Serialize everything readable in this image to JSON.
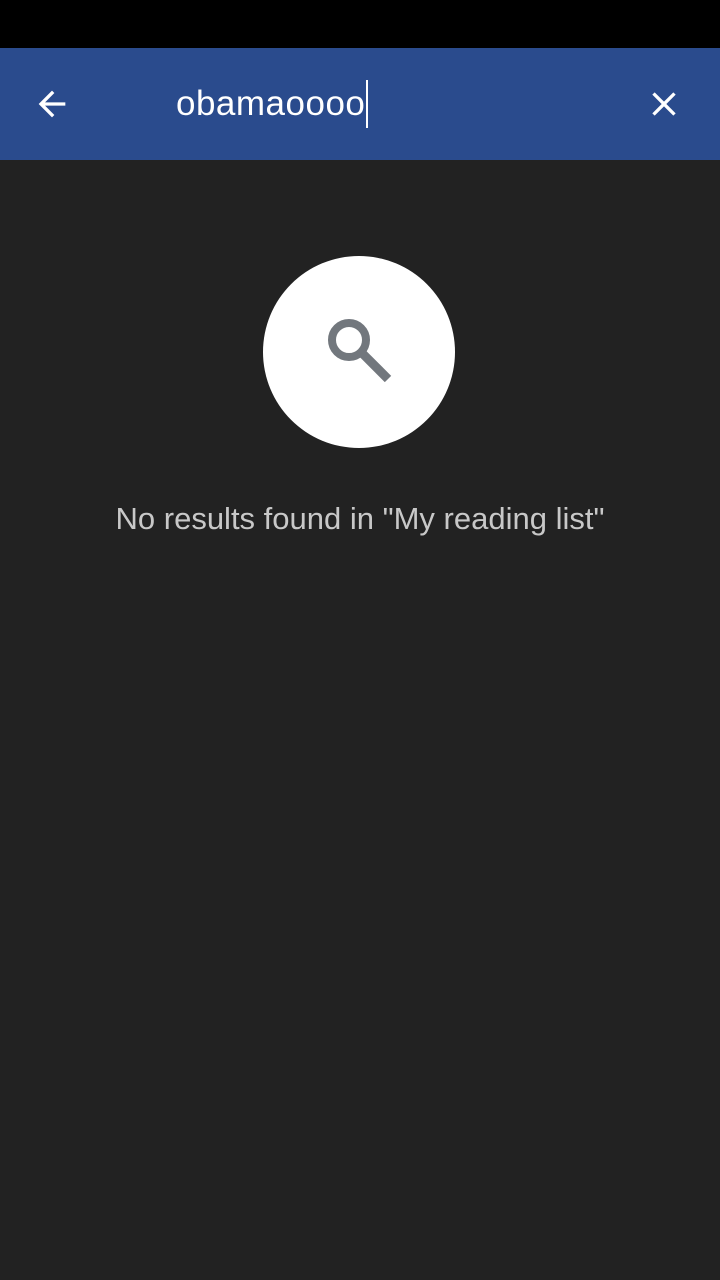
{
  "colors": {
    "status_bar": "#000000",
    "toolbar": "#2a4b8d",
    "background": "#222222",
    "icon_circle": "#ffffff",
    "search_icon": "#72777d",
    "message_text": "#c8c8c8"
  },
  "toolbar": {
    "back_icon": "arrow-left",
    "close_icon": "close-x"
  },
  "search": {
    "value": "obamaoooo"
  },
  "empty_state": {
    "icon": "magnifier",
    "message": "No results found in \"My reading list\""
  }
}
